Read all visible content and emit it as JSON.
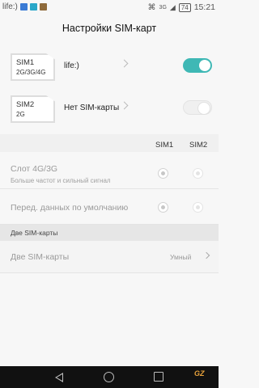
{
  "status_bar": {
    "carrier": "life:)",
    "signal_label": "3G",
    "battery": "74",
    "time": "15:21",
    "icon_colors": [
      "#3a7bd5",
      "#2aa7c9",
      "#8e6a3b"
    ]
  },
  "header": {
    "title": "Настройки SIM-карт"
  },
  "sims": [
    {
      "card_line1": "SIM1",
      "card_line2": "2G/3G/4G",
      "name": "life:)",
      "enabled": true
    },
    {
      "card_line1": "SIM2",
      "card_line2": "2G",
      "name": "Нет SIM-карты",
      "enabled": false
    }
  ],
  "columns": {
    "sim1": "SIM1",
    "sim2": "SIM2"
  },
  "options": [
    {
      "title": "Слот 4G/3G",
      "subtitle": "Больше частот и сильный сигнал",
      "sim1_selected": true,
      "sim2_selected": false
    },
    {
      "title": "Перед. данных по умолчанию",
      "subtitle": "",
      "sim1_selected": true,
      "sim2_selected": false
    }
  ],
  "dual_section": {
    "header": "Две SIM-карты",
    "row_title": "Две SIM-карты",
    "row_value": "Умный"
  },
  "watermark": "GZ",
  "accent_color": "#3fb8b5"
}
